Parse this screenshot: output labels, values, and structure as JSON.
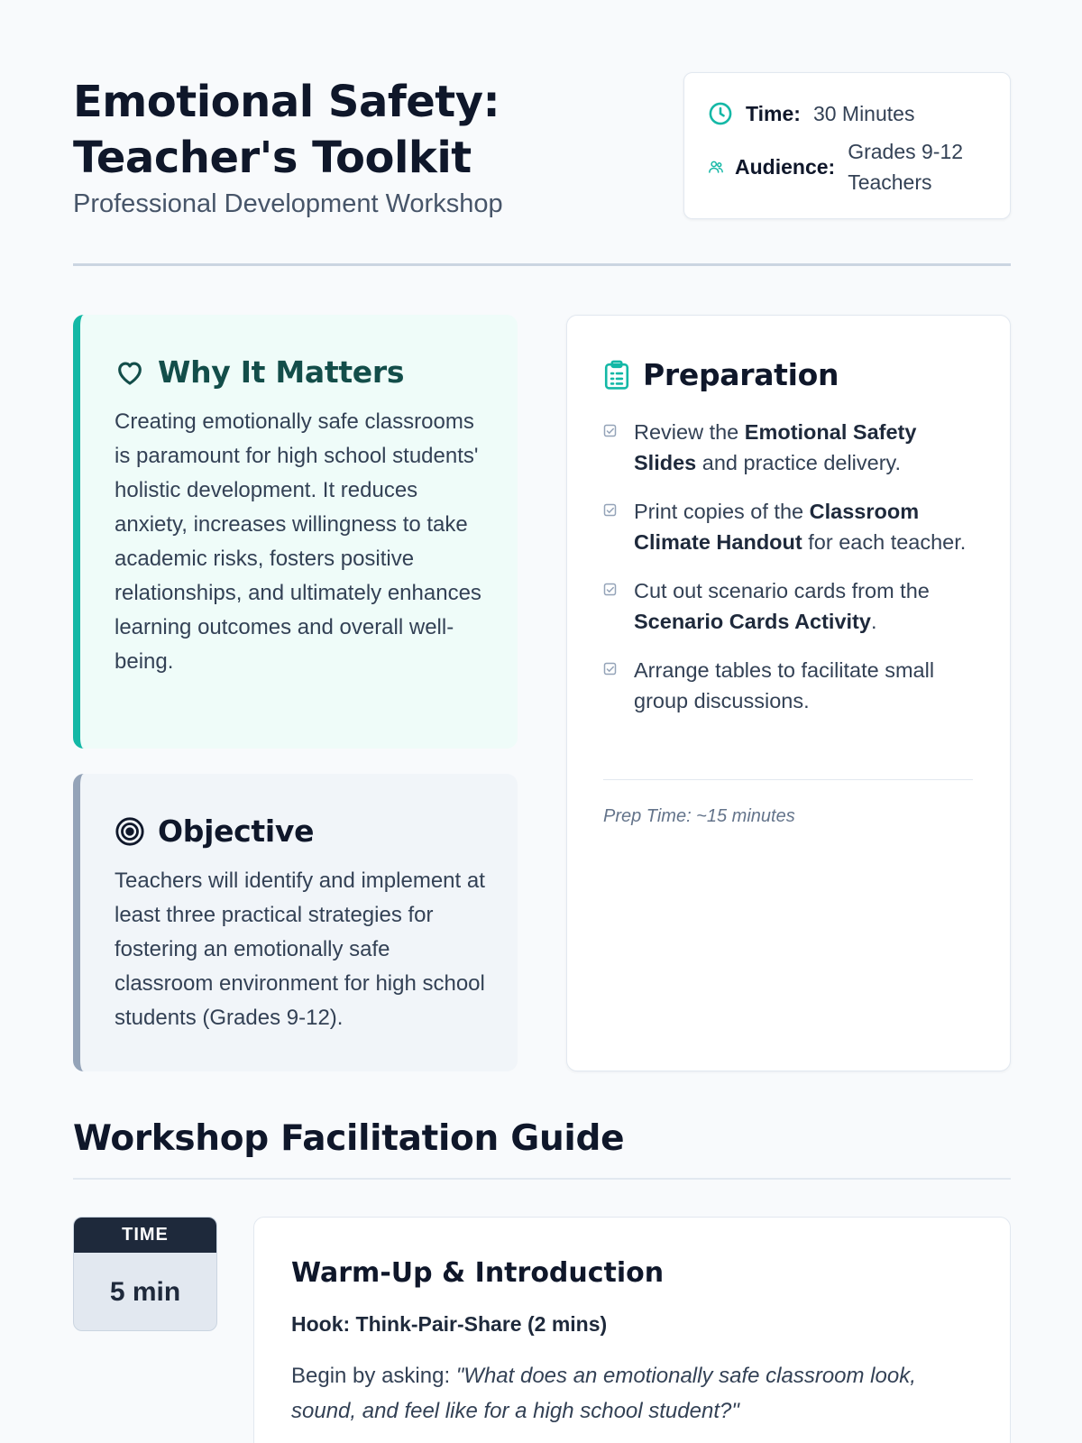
{
  "header": {
    "title": "Emotional Safety: Teacher's Toolkit",
    "subtitle": "Professional Development Workshop",
    "info": {
      "time_label": "Time:",
      "time_value": "30 Minutes",
      "audience_label": "Audience:",
      "audience_value": "Grades 9-12 Teachers"
    }
  },
  "why": {
    "title": "Why It Matters",
    "icon": "heart-icon",
    "body": "Creating emotionally safe classrooms is paramount for high school students' holistic development. It reduces anxiety, increases willingness to take academic risks, fosters positive relationships, and ultimately enhances learning outcomes and overall well-being."
  },
  "objective": {
    "title": "Objective",
    "icon": "target-icon",
    "body": "Teachers will identify and implement at least three practical strategies for fostering an emotionally safe classroom environment for high school students (Grades 9-12)."
  },
  "preparation": {
    "title": "Preparation",
    "icon": "clipboard-icon",
    "items": [
      {
        "pre": "Review the ",
        "bold": "Emotional Safety Slides",
        "post": " and practice delivery."
      },
      {
        "pre": "Print copies of the ",
        "bold": "Classroom Climate Handout",
        "post": " for each teacher."
      },
      {
        "pre": "Cut out scenario cards from the ",
        "bold": "Scenario Cards Activity",
        "post": "."
      },
      {
        "pre": "Arrange tables to facilitate small group discussions.",
        "bold": "",
        "post": ""
      }
    ],
    "prep_time": "Prep Time: ~15 minutes"
  },
  "guide": {
    "title": "Workshop Facilitation Guide",
    "steps": [
      {
        "time_label": "TIME",
        "time_value": "5 min",
        "title": "Warm-Up & Introduction",
        "subtitle": "Hook: Think-Pair-Share (2 mins)",
        "body_prefix": "Begin by asking: ",
        "body_quote": "\"What does an emotionally safe classroom look, sound, and feel like for a high school student?\""
      }
    ]
  },
  "colors": {
    "accent_teal": "#14b8a6",
    "accent_slate": "#94a3b8",
    "dark": "#0f172a"
  }
}
